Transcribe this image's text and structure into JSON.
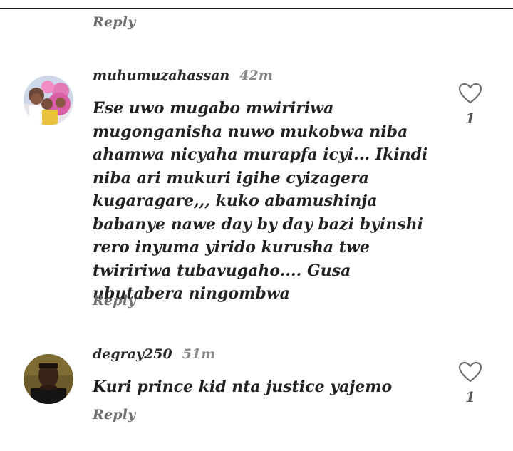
{
  "comments": [
    {
      "username": "",
      "time": "",
      "text": "",
      "reply_label": "Reply"
    },
    {
      "username": "muhumuzahassan",
      "time": "42m",
      "text": "Ese uwo mugabo mwiririwa mugonganisha nuwo mukobwa niba ahamwa nicyaha murapfa icyi... Ikindi niba ari mukuri igihe cyizagera kugaragare,,, kuko abamushinja babanye nawe day by day bazi byinshi rero inyuma yirido kurusha twe twiririwa tubavugaho.... Gusa ubutabera ningombwa",
      "like_count": "1",
      "reply_label": "Reply",
      "avatar_icon": "group-photo-avatar"
    },
    {
      "username": "degray250",
      "time": "51m",
      "text": "Kuri prince kid nta justice yajemo",
      "like_count": "1",
      "reply_label": "Reply",
      "avatar_icon": "person-photo-avatar"
    }
  ],
  "icons": {
    "like": "heart-outline-icon"
  },
  "colors": {
    "text": "#222222",
    "muted": "#8a8a8a",
    "reply": "#6f6f6f"
  }
}
